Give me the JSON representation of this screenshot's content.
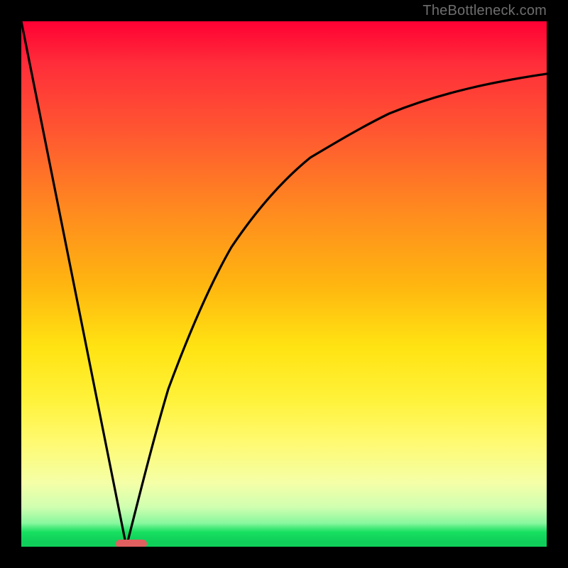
{
  "watermark": {
    "text": "TheBottleneck.com"
  },
  "chart_data": {
    "type": "line",
    "title": "",
    "xlabel": "",
    "ylabel": "",
    "xlim": [
      0,
      100
    ],
    "ylim": [
      0,
      100
    ],
    "grid": false,
    "legend": false,
    "series": [
      {
        "name": "left-linear",
        "x": [
          0,
          20
        ],
        "y": [
          100,
          0
        ]
      },
      {
        "name": "right-curve",
        "x": [
          20,
          22,
          25,
          28,
          32,
          36,
          40,
          45,
          50,
          55,
          60,
          70,
          80,
          90,
          100
        ],
        "y": [
          0,
          8,
          20,
          30,
          41,
          50,
          57,
          64,
          70,
          74,
          77,
          82,
          86,
          88,
          90
        ]
      }
    ],
    "marker": {
      "name": "bottleneck-marker",
      "x_range": [
        18,
        24
      ],
      "y": 0,
      "color": "#e06060"
    },
    "background_gradient": {
      "stops": [
        {
          "pos": 0.0,
          "color": "#ff0033"
        },
        {
          "pos": 0.5,
          "color": "#ffb510"
        },
        {
          "pos": 0.72,
          "color": "#fff23a"
        },
        {
          "pos": 0.97,
          "color": "#17e060"
        },
        {
          "pos": 1.0,
          "color": "#0fcf5a"
        }
      ]
    }
  }
}
